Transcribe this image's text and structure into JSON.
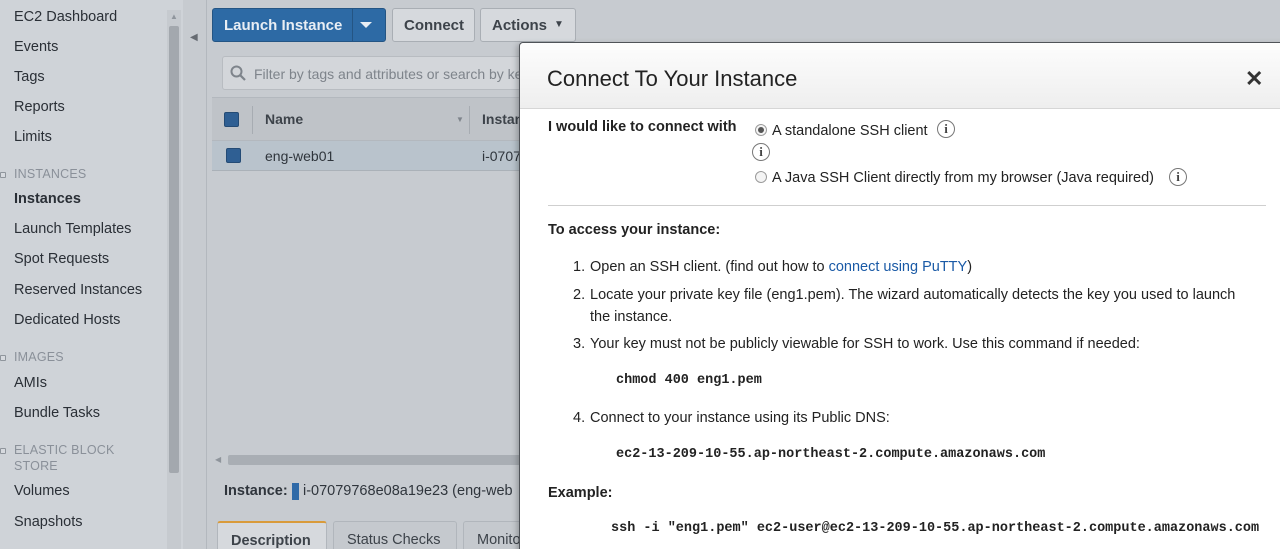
{
  "sidebar": {
    "items_top": [
      "EC2 Dashboard",
      "Events",
      "Tags",
      "Reports",
      "Limits"
    ],
    "section_instances": "INSTANCES",
    "items_instances": [
      "Instances",
      "Launch Templates",
      "Spot Requests",
      "Reserved Instances",
      "Dedicated Hosts"
    ],
    "active_item": "Instances",
    "section_images": "IMAGES",
    "items_images": [
      "AMIs",
      "Bundle Tasks"
    ],
    "section_ebs_line1": "ELASTIC BLOCK",
    "section_ebs_line2": "STORE",
    "items_ebs": [
      "Volumes",
      "Snapshots"
    ]
  },
  "toolbar": {
    "launch_label": "Launch Instance",
    "connect_label": "Connect",
    "actions_label": "Actions"
  },
  "search": {
    "placeholder": "Filter by tags and attributes or search by ke"
  },
  "table": {
    "col_name": "Name",
    "col_instance": "Instan",
    "rows": [
      {
        "name": "eng-web01",
        "instance": "i-0707"
      }
    ]
  },
  "details": {
    "label": "Instance:",
    "value": "i-07079768e08a19e23 (eng-web",
    "tabs": [
      "Description",
      "Status Checks",
      "Monito"
    ]
  },
  "modal": {
    "title": "Connect To Your Instance",
    "close_glyph": "✕",
    "connect_with_label": "I would like to connect with",
    "option_ssh": "A standalone SSH client",
    "option_java": "A Java SSH Client directly from my browser (Java required)",
    "selected_option": "A standalone SSH client",
    "info_glyph": "i",
    "access_heading": "To access your instance:",
    "step1_prefix": "Open an SSH client. (find out how to ",
    "step1_link": "connect using PuTTY",
    "step1_suffix": ")",
    "step2_line1": "Locate your private key file (eng1.pem). The wizard automatically detects the key you used to launch",
    "step2_line2": "the instance.",
    "step3": "Your key must not be publicly viewable for SSH to work. Use this command if needed:",
    "chmod_cmd": "chmod 400 eng1.pem",
    "step4": "Connect to your instance using its Public DNS:",
    "public_dns": "ec2-13-209-10-55.ap-northeast-2.compute.amazonaws.com",
    "example_heading": "Example:",
    "example_cmd": "ssh -i \"eng1.pem\" ec2-user@ec2-13-209-10-55.ap-northeast-2.compute.amazonaws.com",
    "num1": "1.",
    "num2": "2.",
    "num3": "3.",
    "num4": "4."
  }
}
